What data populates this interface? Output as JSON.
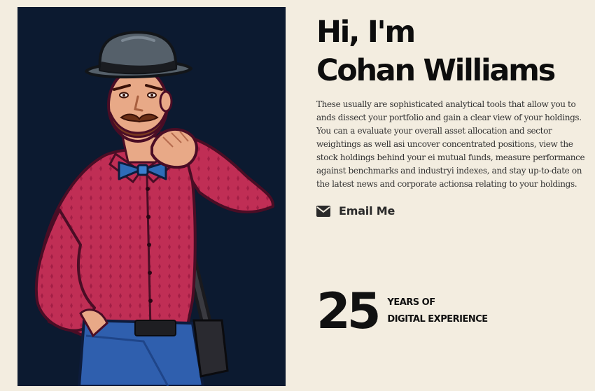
{
  "hero": {
    "greeting": "Hi, I'm",
    "name": "Cohan Williams",
    "bio": "These usually are sophisticated analytical tools that allow you to ands dissect your portfolio and gain a clear view of your holdings. You can a evaluate your overall asset allocation and sector weightings as well asi uncover concentrated positions, view the stock holdings behind your ei mutual funds, measure performance against benchmarks and industryi indexes, and stay up-to-date on the latest news and corporate actionsa relating to your holdings.",
    "email_button": {
      "label": "Email Me",
      "icon": "envelope-icon"
    }
  },
  "experience": {
    "number": "25",
    "line1": "YEARS OF",
    "line2": "DIGITAL EXPERIENCE"
  },
  "portrait": {
    "background_color": "#0c1a30"
  },
  "colors": {
    "page_background": "#f3ede0",
    "text": "#111111",
    "shirt": "#c02e55",
    "bowtie": "#2e6cb8",
    "jeans": "#2f5fae",
    "hat": "#55606a"
  }
}
